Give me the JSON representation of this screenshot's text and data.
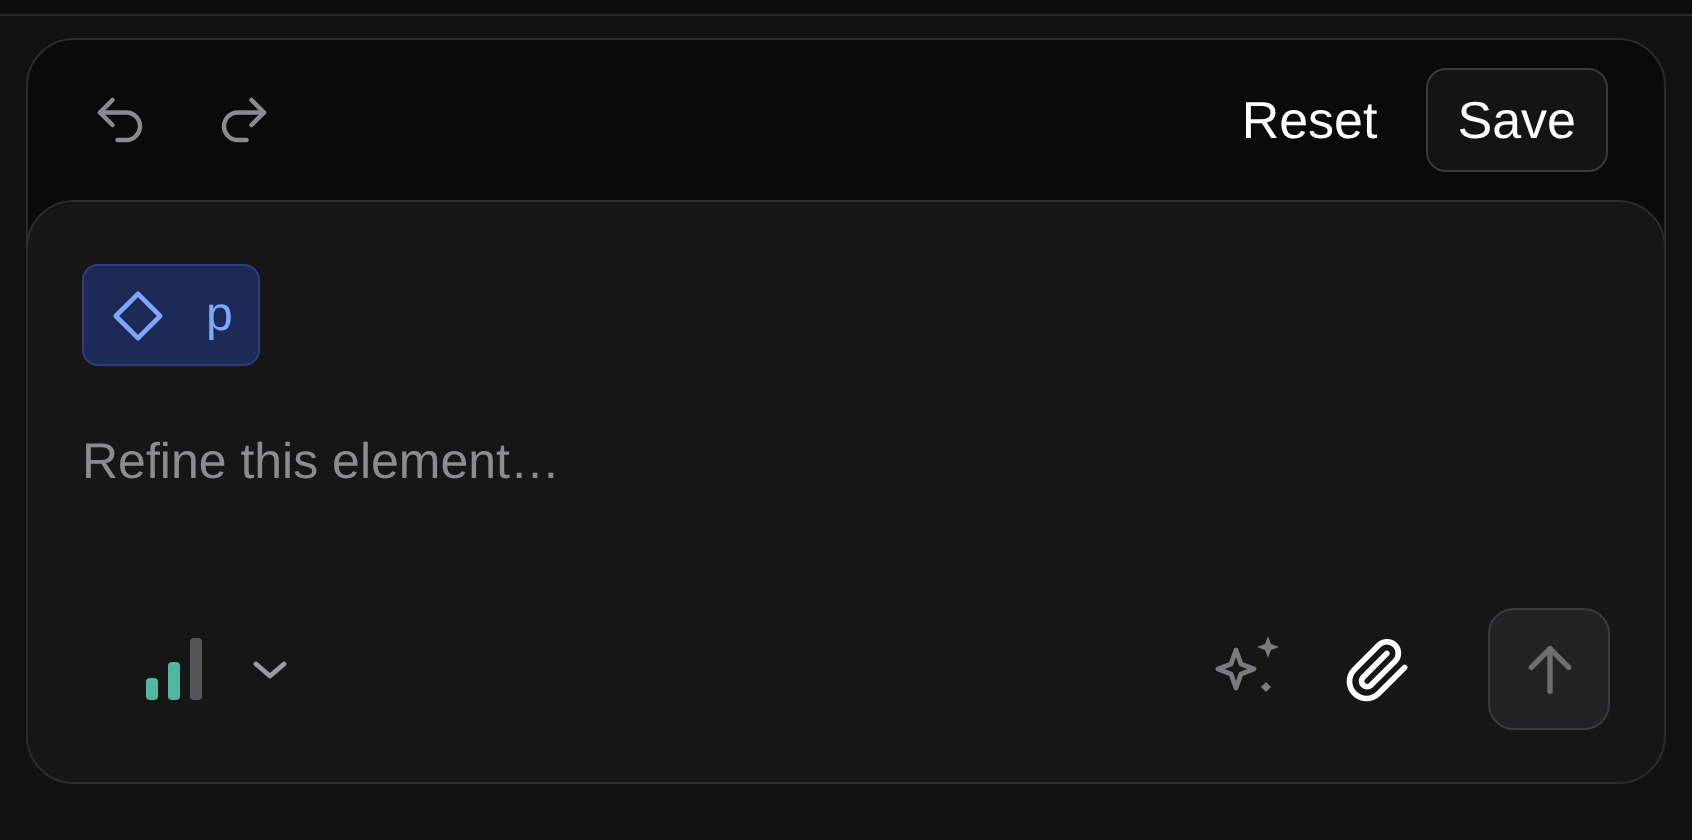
{
  "toolbar": {
    "buttons": [
      {
        "label": "Reset",
        "kind": "text"
      },
      {
        "label": "Save",
        "kind": "outlined"
      }
    ]
  },
  "composer": {
    "chip": {
      "label": "p"
    },
    "placeholder": "Refine this element…",
    "send_disabled": true
  }
}
